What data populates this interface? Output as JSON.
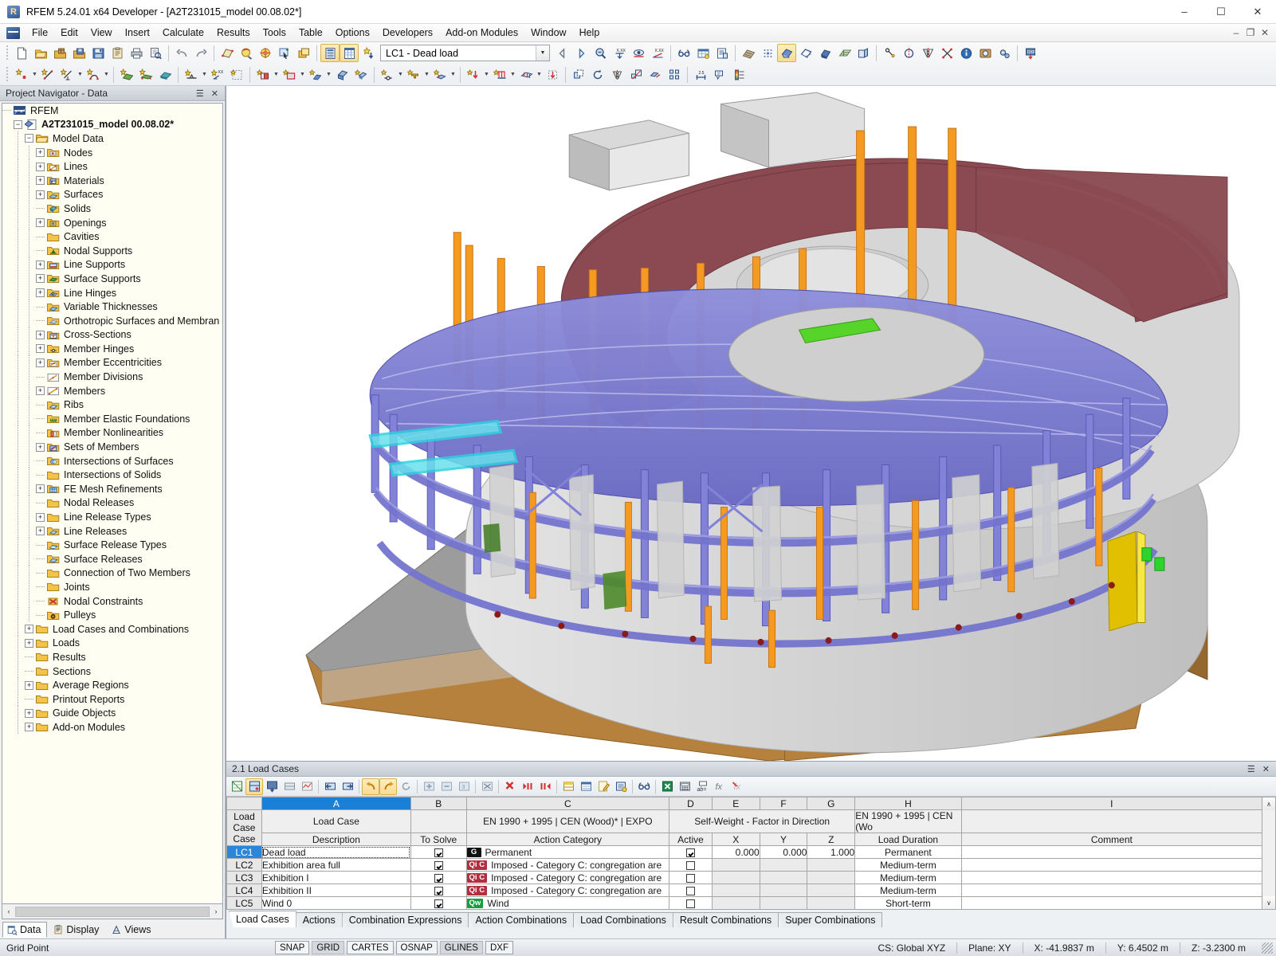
{
  "window": {
    "title": "RFEM 5.24.01 x64 Developer - [A2T231015_model 00.08.02*]",
    "app_icon": "rfem-logo-icon",
    "minimize": "–",
    "maximize": "☐",
    "close": "✕",
    "mdi_minimize": "–",
    "mdi_restore": "❐",
    "mdi_close": "✕"
  },
  "menu": {
    "items": [
      {
        "label": "File"
      },
      {
        "label": "Edit"
      },
      {
        "label": "View"
      },
      {
        "label": "Insert"
      },
      {
        "label": "Calculate"
      },
      {
        "label": "Results"
      },
      {
        "label": "Tools"
      },
      {
        "label": "Table"
      },
      {
        "label": "Options"
      },
      {
        "label": "Developers"
      },
      {
        "label": "Add-on Modules"
      },
      {
        "label": "Window"
      },
      {
        "label": "Help"
      }
    ]
  },
  "toolbar": {
    "load_case_value": "LC1 - Dead load",
    "row1_icons": [
      "new-file-icon",
      "open-file-icon",
      "open-project-icon",
      "save-project-icon",
      "save-icon",
      "clipboard-icon",
      "print-icon",
      "print-preview-icon",
      "undo-icon",
      "redo-icon",
      "render-surface-icon",
      "zoom-rotate-icon",
      "rotate-view-icon",
      "select-window-icon",
      "copy-window-icon",
      "show-table-icon",
      "show-grid-table-icon",
      "new-load-case-icon"
    ],
    "row1_icons_right": [
      "prev-loadcase-icon",
      "next-loadcase-icon",
      "zoom-factor-icon",
      "result-value-icon",
      "display-result-icon",
      "result-diagram-icon",
      "glasses-icon",
      "results-table-icon",
      "print-report-icon",
      "mesh-icon",
      "fe-mesh-points-icon",
      "render-model-icon",
      "wireframe-icon",
      "solid-model-icon",
      "grid-icon",
      "section-icon",
      "snap-node-icon",
      "circle-center-icon",
      "mirror-icon",
      "intersection-icon",
      "info-icon",
      "photo-icon",
      "gears-icon",
      "dxf-export-icon"
    ],
    "row2_icons": [
      "new-node-icon",
      "new-line-icon",
      "new-dim-line-icon",
      "new-polyline-icon",
      "new-surface-icon",
      "new-surface-support-icon",
      "new-solid-icon",
      "new-nodal-support-icon",
      "new-line-support-icon",
      "new-select-grid-icon",
      "new-opening-icon",
      "new-rectangle-icon",
      "new-member-icon",
      "new-solid2-icon",
      "new-cuboid-icon",
      "new-member-hinge-icon",
      "new-cross-section-icon",
      "new-member-eccentricity-icon",
      "new-nodal-load-icon",
      "new-line-load-icon",
      "new-surface-load-icon",
      "new-free-load-icon",
      "copy-move-icon",
      "rotate-obj-icon",
      "mirror-obj-icon",
      "scale-obj-icon",
      "extrude-icon",
      "array-icon",
      "dimension-icon",
      "annotate-icon",
      "color-legend-icon"
    ]
  },
  "navigator": {
    "title": "Project Navigator - Data",
    "pin": "☰",
    "close": "✕",
    "tree": [
      {
        "label": "RFEM",
        "indent": 0,
        "expander": "none",
        "icon": "rfem-root-icon",
        "bold": false
      },
      {
        "label": "A2T231015_model 00.08.02*",
        "indent": 1,
        "expander": "minus",
        "icon": "model-file-icon",
        "bold": true
      },
      {
        "label": "Model Data",
        "indent": 2,
        "expander": "minus",
        "icon": "folder-open-icon",
        "bold": false
      },
      {
        "label": "Nodes",
        "indent": 3,
        "expander": "plus",
        "icon": "nodes-icon",
        "bold": false
      },
      {
        "label": "Lines",
        "indent": 3,
        "expander": "plus",
        "icon": "lines-icon",
        "bold": false
      },
      {
        "label": "Materials",
        "indent": 3,
        "expander": "plus",
        "icon": "materials-icon",
        "bold": false
      },
      {
        "label": "Surfaces",
        "indent": 3,
        "expander": "plus",
        "icon": "surfaces-icon",
        "bold": false
      },
      {
        "label": "Solids",
        "indent": 3,
        "expander": "none",
        "icon": "solids-icon",
        "bold": false
      },
      {
        "label": "Openings",
        "indent": 3,
        "expander": "plus",
        "icon": "openings-icon",
        "bold": false
      },
      {
        "label": "Cavities",
        "indent": 3,
        "expander": "none",
        "icon": "folder-icon",
        "bold": false
      },
      {
        "label": "Nodal Supports",
        "indent": 3,
        "expander": "none",
        "icon": "nodal-supports-icon",
        "bold": false
      },
      {
        "label": "Line Supports",
        "indent": 3,
        "expander": "plus",
        "icon": "line-supports-icon",
        "bold": false
      },
      {
        "label": "Surface Supports",
        "indent": 3,
        "expander": "plus",
        "icon": "surface-supports-icon",
        "bold": false
      },
      {
        "label": "Line Hinges",
        "indent": 3,
        "expander": "plus",
        "icon": "line-hinges-icon",
        "bold": false
      },
      {
        "label": "Variable Thicknesses",
        "indent": 3,
        "expander": "none",
        "icon": "variable-thickness-icon",
        "bold": false
      },
      {
        "label": "Orthotropic Surfaces and Membranes",
        "indent": 3,
        "expander": "none",
        "icon": "orthotropic-icon",
        "bold": false
      },
      {
        "label": "Cross-Sections",
        "indent": 3,
        "expander": "plus",
        "icon": "cross-sections-icon",
        "bold": false
      },
      {
        "label": "Member Hinges",
        "indent": 3,
        "expander": "plus",
        "icon": "member-hinges-icon",
        "bold": false
      },
      {
        "label": "Member Eccentricities",
        "indent": 3,
        "expander": "plus",
        "icon": "member-eccentricities-icon",
        "bold": false
      },
      {
        "label": "Member Divisions",
        "indent": 3,
        "expander": "none",
        "icon": "member-divisions-icon",
        "bold": false
      },
      {
        "label": "Members",
        "indent": 3,
        "expander": "plus",
        "icon": "members-icon",
        "bold": false
      },
      {
        "label": "Ribs",
        "indent": 3,
        "expander": "none",
        "icon": "ribs-icon",
        "bold": false
      },
      {
        "label": "Member Elastic Foundations",
        "indent": 3,
        "expander": "none",
        "icon": "member-elastic-foundations-icon",
        "bold": false
      },
      {
        "label": "Member Nonlinearities",
        "indent": 3,
        "expander": "none",
        "icon": "member-nonlinearities-icon",
        "bold": false
      },
      {
        "label": "Sets of Members",
        "indent": 3,
        "expander": "plus",
        "icon": "sets-of-members-icon",
        "bold": false
      },
      {
        "label": "Intersections of Surfaces",
        "indent": 3,
        "expander": "none",
        "icon": "intersections-surfaces-icon",
        "bold": false
      },
      {
        "label": "Intersections of Solids",
        "indent": 3,
        "expander": "none",
        "icon": "folder-icon",
        "bold": false
      },
      {
        "label": "FE Mesh Refinements",
        "indent": 3,
        "expander": "plus",
        "icon": "fe-mesh-refinements-icon",
        "bold": false
      },
      {
        "label": "Nodal Releases",
        "indent": 3,
        "expander": "none",
        "icon": "folder-icon",
        "bold": false
      },
      {
        "label": "Line Release Types",
        "indent": 3,
        "expander": "plus",
        "icon": "folder-icon",
        "bold": false
      },
      {
        "label": "Line Releases",
        "indent": 3,
        "expander": "plus",
        "icon": "line-releases-icon",
        "bold": false
      },
      {
        "label": "Surface Release Types",
        "indent": 3,
        "expander": "none",
        "icon": "surface-release-types-icon",
        "bold": false
      },
      {
        "label": "Surface Releases",
        "indent": 3,
        "expander": "none",
        "icon": "surface-releases-icon",
        "bold": false
      },
      {
        "label": "Connection of Two Members",
        "indent": 3,
        "expander": "none",
        "icon": "folder-icon",
        "bold": false
      },
      {
        "label": "Joints",
        "indent": 3,
        "expander": "none",
        "icon": "folder-icon",
        "bold": false
      },
      {
        "label": "Nodal Constraints",
        "indent": 3,
        "expander": "none",
        "icon": "nodal-constraints-icon",
        "bold": false
      },
      {
        "label": "Pulleys",
        "indent": 3,
        "expander": "none",
        "icon": "pulleys-icon",
        "bold": false
      },
      {
        "label": "Load Cases and Combinations",
        "indent": 2,
        "expander": "plus",
        "icon": "folder-icon",
        "bold": false
      },
      {
        "label": "Loads",
        "indent": 2,
        "expander": "plus",
        "icon": "folder-icon",
        "bold": false
      },
      {
        "label": "Results",
        "indent": 2,
        "expander": "none",
        "icon": "folder-icon",
        "bold": false
      },
      {
        "label": "Sections",
        "indent": 2,
        "expander": "none",
        "icon": "folder-icon",
        "bold": false
      },
      {
        "label": "Average Regions",
        "indent": 2,
        "expander": "plus",
        "icon": "folder-icon",
        "bold": false
      },
      {
        "label": "Printout Reports",
        "indent": 2,
        "expander": "none",
        "icon": "folder-icon",
        "bold": false
      },
      {
        "label": "Guide Objects",
        "indent": 2,
        "expander": "plus",
        "icon": "folder-icon",
        "bold": false
      },
      {
        "label": "Add-on Modules",
        "indent": 2,
        "expander": "plus",
        "icon": "folder-icon",
        "bold": false
      }
    ],
    "tabs": [
      {
        "label": "Data",
        "icon": "data-tab-icon",
        "selected": true
      },
      {
        "label": "Display",
        "icon": "display-tab-icon",
        "selected": false
      },
      {
        "label": "Views",
        "icon": "views-tab-icon",
        "selected": false
      }
    ],
    "scroll_left": "‹",
    "scroll_right": "›"
  },
  "table": {
    "title": "2.1 Load Cases",
    "pin": "☰",
    "close": "✕",
    "toolbar_icons": [
      "new-table-icon",
      "insert-row-icon",
      "export-table-icon",
      "table-settings-icon",
      "table-chart-icon",
      "prev-table-icon",
      "next-table-icon",
      "undo-table-icon",
      "redo-table-icon",
      "refresh-table-icon",
      "add-row-icon",
      "remove-row-icon",
      "renumber-icon",
      "delete-all-icon",
      "delete-row-icon",
      "delete-left-icon",
      "delete-right-icon",
      "table-columns-icon",
      "table-view-icon",
      "edit-table-icon",
      "table-properties-icon",
      "glasses-table-icon",
      "excel-export-icon",
      "calculator-icon",
      "abc-icon",
      "fx-icon",
      "fx-clear-icon"
    ],
    "column_letters": [
      "A",
      "B",
      "C",
      "D",
      "E",
      "F",
      "G",
      "H",
      "I"
    ],
    "selected_column": "A",
    "group_headers": {
      "rowhdr": "Load Case",
      "a": "Load Case",
      "b": "",
      "c": "EN 1990 + 1995 | CEN (Wood)* | EXPO",
      "defg": "Self-Weight  -  Factor in Direction",
      "h": "EN 1990 + 1995 | CEN (Wo",
      "i": ""
    },
    "sub_headers": {
      "rowhdr": "Case",
      "a": "Description",
      "b": "To Solve",
      "c": "Action Category",
      "d": "Active",
      "e": "X",
      "f": "Y",
      "g": "Z",
      "h": "Load Duration",
      "i": "Comment"
    },
    "rows": [
      {
        "id": "LC1",
        "selected": true,
        "editing": true,
        "description": "Dead load",
        "to_solve": true,
        "tag": "G",
        "tag_color": "#101010",
        "action_category": "Permanent",
        "active": true,
        "x": "0.000",
        "y": "0.000",
        "z": "1.000",
        "load_duration": "Permanent",
        "comment": ""
      },
      {
        "id": "LC2",
        "selected": false,
        "editing": false,
        "description": "Exhibition area  full",
        "to_solve": true,
        "tag": "Qi C",
        "tag_color": "#b03040",
        "action_category": "Imposed - Category C: congregation are",
        "active": false,
        "x": "",
        "y": "",
        "z": "",
        "load_duration": "Medium-term",
        "comment": ""
      },
      {
        "id": "LC3",
        "selected": false,
        "editing": false,
        "description": "Exhibition I",
        "to_solve": true,
        "tag": "Qi C",
        "tag_color": "#b03040",
        "action_category": "Imposed - Category C: congregation are",
        "active": false,
        "x": "",
        "y": "",
        "z": "",
        "load_duration": "Medium-term",
        "comment": ""
      },
      {
        "id": "LC4",
        "selected": false,
        "editing": false,
        "description": "Exhibition II",
        "to_solve": true,
        "tag": "Qi C",
        "tag_color": "#b03040",
        "action_category": "Imposed - Category C: congregation are",
        "active": false,
        "x": "",
        "y": "",
        "z": "",
        "load_duration": "Medium-term",
        "comment": ""
      },
      {
        "id": "LC5",
        "selected": false,
        "editing": false,
        "description": "Wind 0",
        "to_solve": true,
        "tag": "Qw",
        "tag_color": "#14a03c",
        "action_category": "Wind",
        "active": false,
        "x": "",
        "y": "",
        "z": "",
        "load_duration": "Short-term",
        "comment": ""
      }
    ],
    "tabs": [
      {
        "label": "Load Cases",
        "selected": true
      },
      {
        "label": "Actions",
        "selected": false
      },
      {
        "label": "Combination Expressions",
        "selected": false
      },
      {
        "label": "Action Combinations",
        "selected": false
      },
      {
        "label": "Load Combinations",
        "selected": false
      },
      {
        "label": "Result Combinations",
        "selected": false
      },
      {
        "label": "Super Combinations",
        "selected": false
      }
    ],
    "scroll_up": "∧",
    "scroll_down": "∨"
  },
  "statusbar": {
    "hint": "Grid Point",
    "toggles": [
      {
        "label": "SNAP",
        "on": true
      },
      {
        "label": "GRID",
        "on": false
      },
      {
        "label": "CARTES",
        "on": true
      },
      {
        "label": "OSNAP",
        "on": true
      },
      {
        "label": "GLINES",
        "on": false
      },
      {
        "label": "DXF",
        "on": true
      }
    ],
    "cs": "CS: Global XYZ",
    "plane": "Plane: XY",
    "x": "X:  -41.9837 m",
    "y": "Y:  6.4502 m",
    "z": "Z:  -3.2300 m"
  },
  "colors": {
    "accent_blue": "#1c7fd6",
    "slab_purple": "#7f7fd5",
    "column_orange": "#f59a20",
    "roof_maroon": "#8b4a52",
    "ground_brown": "#b5813d",
    "concrete_gray": "#cfcfcf"
  }
}
